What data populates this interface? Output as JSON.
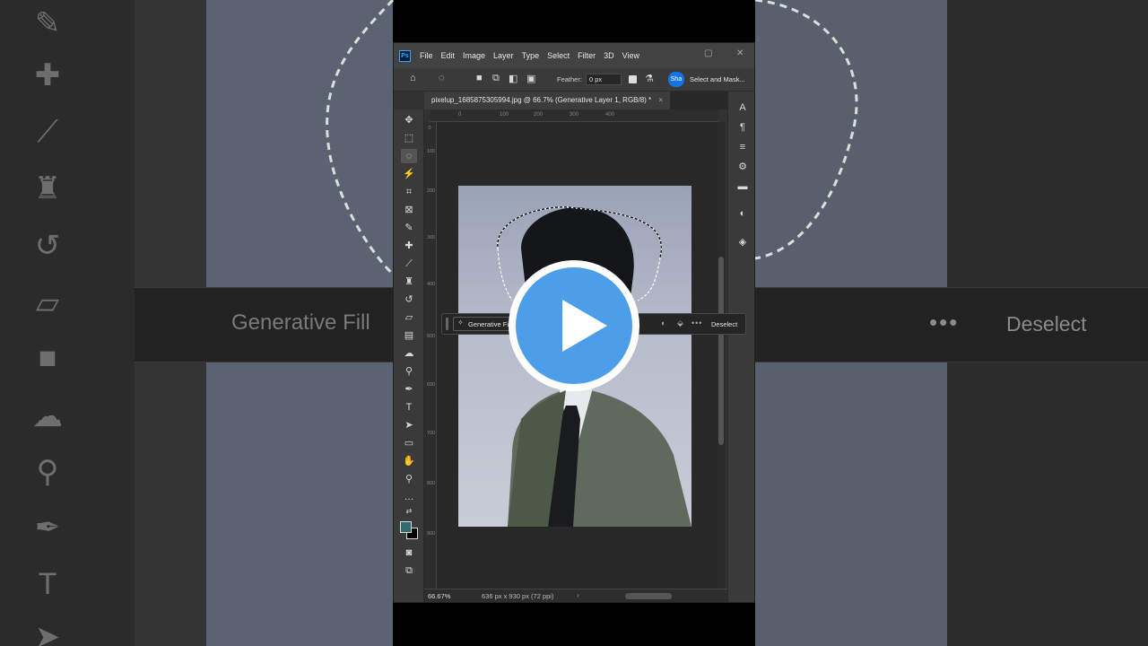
{
  "app": {
    "logo_text": "Ps",
    "menu": [
      "File",
      "Edit",
      "Image",
      "Layer",
      "Type",
      "Select",
      "Filter",
      "3D",
      "View"
    ]
  },
  "options_bar": {
    "feather_label": "Feather:",
    "feather_value": "0 px",
    "share_label": "Sha",
    "select_and_mask_label": "Select and Mask..."
  },
  "document": {
    "tab_title": "pixelup_1685875305994.jpg @ 66.7% (Generative Layer 1, RGB/8) *",
    "close_symbol": "×"
  },
  "rulers": {
    "top": [
      "0",
      "100",
      "200",
      "300",
      "400"
    ],
    "left": [
      "0",
      "100",
      "200",
      "300",
      "400",
      "500",
      "600",
      "700",
      "800",
      "900"
    ]
  },
  "contextual_taskbar": {
    "generative_fill_label": "Generative Fill",
    "more_label": "•••",
    "deselect_label": "Deselect"
  },
  "status_bar": {
    "zoom": "66.67%",
    "doc_size": "636 px x 930 px (72 ppi)"
  },
  "background_copy": {
    "generative_fill_label": "Generative Fill",
    "deselect_label": "Deselect",
    "more_label": "•••",
    "ruler_numbers": [
      "100",
      "200",
      "300",
      "400",
      "500",
      "600"
    ]
  },
  "colors": {
    "foreground": "#2f6b6b",
    "background": "#000000",
    "play_button": "#4d9ee8",
    "accent": "#1473e6"
  }
}
